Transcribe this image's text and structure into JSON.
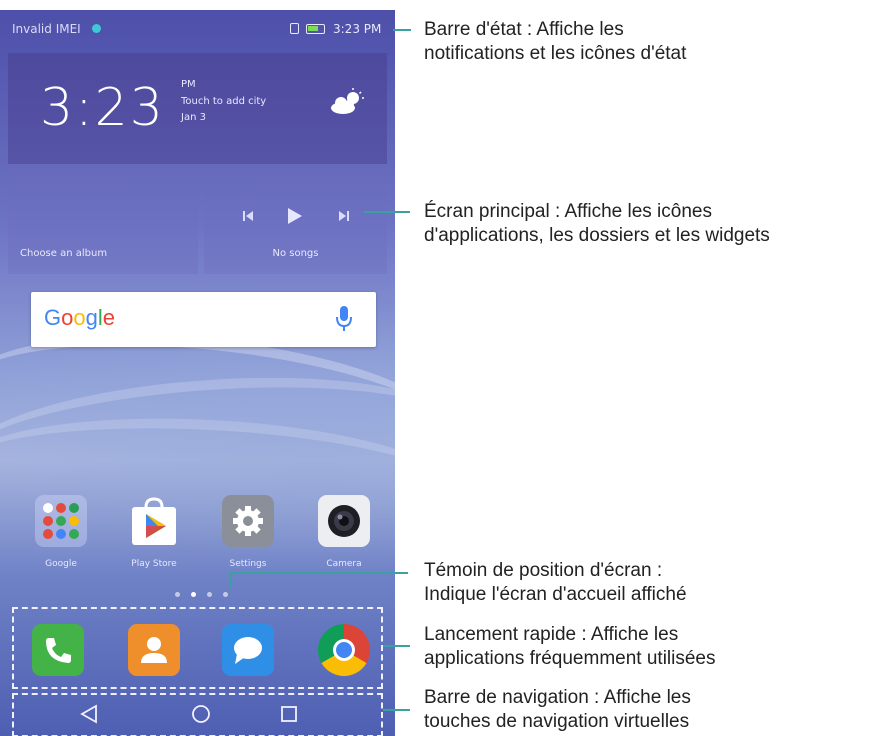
{
  "status_bar": {
    "carrier": "Invalid IMEI",
    "time": "3:23 PM"
  },
  "clock_widget": {
    "time": "3:23",
    "ampm": "PM",
    "city_prompt": "Touch to add city",
    "date": "Jan 3",
    "weather_icon": "cloudy-sun-icon"
  },
  "music_widget": {
    "album_prompt": "Choose an album",
    "song_status": "No songs"
  },
  "google_search": {
    "logo": "Google",
    "logo_colors": [
      "#4285F4",
      "#EA4335",
      "#FBBC05",
      "#4285F4",
      "#34A853",
      "#EA4335"
    ]
  },
  "home_apps": [
    {
      "label": "Google",
      "icon": "google-folder-icon"
    },
    {
      "label": "Play Store",
      "icon": "play-store-icon"
    },
    {
      "label": "Settings",
      "icon": "settings-icon"
    },
    {
      "label": "Camera",
      "icon": "camera-icon"
    }
  ],
  "page_indicator": {
    "pages": 4,
    "current": 2
  },
  "dock_apps": [
    {
      "name": "Phone",
      "icon": "phone-icon",
      "color": "#43b348"
    },
    {
      "name": "Contacts",
      "icon": "contacts-icon",
      "color": "#ef8f2b"
    },
    {
      "name": "Messaging",
      "icon": "messaging-icon",
      "color": "#2f8fe6"
    },
    {
      "name": "Chrome",
      "icon": "chrome-icon",
      "color": "#db4437"
    }
  ],
  "nav_keys": [
    "back-icon",
    "home-icon",
    "recents-icon"
  ],
  "callouts": [
    {
      "line1": "Barre d'état : Affiche les",
      "line2": "notifications et les icônes d'état"
    },
    {
      "line1": "Écran principal : Affiche les icônes",
      "line2": "d'applications, les dossiers et les widgets"
    },
    {
      "line1": "Témoin de position d'écran :",
      "line2": "Indique l'écran d'accueil affiché"
    },
    {
      "line1": "Lancement rapide : Affiche les",
      "line2": "applications fréquemment utilisées"
    },
    {
      "line1": "Barre de navigation : Affiche les",
      "line2": "touches de navigation virtuelles"
    }
  ],
  "colors": {
    "callout_line": "#3aa0a0",
    "accent": "#4285F4"
  }
}
